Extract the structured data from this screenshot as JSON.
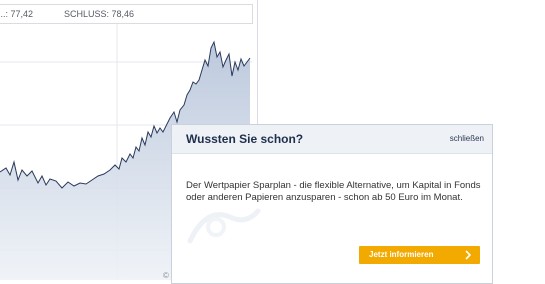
{
  "chart": {
    "stat_low": "...: 77,42",
    "stat_close": "SCHLUSS: 78,46",
    "copyright": "©",
    "line_color": "#2b3a5c",
    "fill_color": "#d7dfeb"
  },
  "popup": {
    "title": "Wussten Sie schon?",
    "close_label": "schließen",
    "body_text": "Der Wertpapier Sparplan - die flexible Alternative, um Kapital in Fonds oder anderen Papieren anzusparen - schon ab 50 Euro im Monat.",
    "cta_label": "Jetzt informieren",
    "cta_icon": "chevron-right-icon",
    "cta_color": "#f2a900"
  }
}
